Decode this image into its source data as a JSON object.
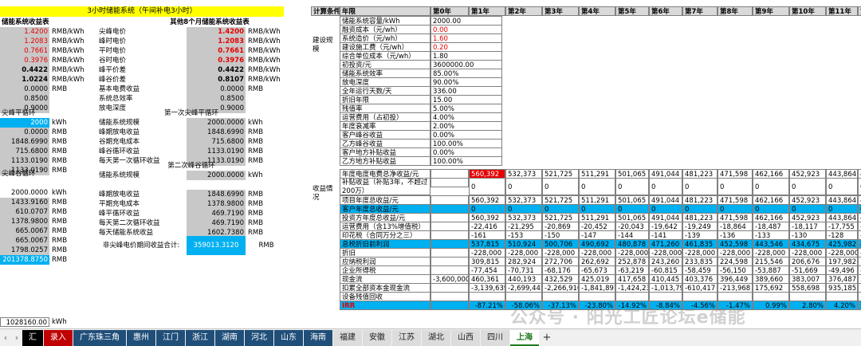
{
  "banner": "3小时储能系统（午间补电3小时）",
  "left": {
    "title": "储能系统收益表",
    "rows": [
      [
        "1.4200",
        "RMB/kWh"
      ],
      [
        "1.2083",
        "RMB/kWh"
      ],
      [
        "0.7661",
        "RMB/kWh"
      ],
      [
        "0.3976",
        "RMB/kWh"
      ],
      [
        "0.4422",
        "RMB/kWh"
      ],
      [
        "1.0224",
        "RMB/kWh"
      ],
      [
        "0.0000",
        "RMB"
      ],
      [
        "0.8500",
        ""
      ],
      [
        "0.9000",
        ""
      ]
    ],
    "sec1": "尖峰平循环",
    "sec1_rows": [
      [
        "2000",
        "kWh"
      ],
      [
        "0.0000",
        "RMB"
      ],
      [
        "1848.6990",
        "RMB"
      ],
      [
        "715.6800",
        "RMB"
      ],
      [
        "1133.0190",
        "RMB"
      ],
      [
        "1133.0190",
        "RMB"
      ]
    ],
    "sec2": "尖峰谷循环",
    "sec2_rows": [
      [
        "2000.0000",
        "kWh"
      ],
      [
        "1433.9160",
        "RMB"
      ],
      [
        "610.0707",
        "RMB"
      ],
      [
        "1378.9800",
        "RMB"
      ],
      [
        "665.0067",
        "RMB"
      ],
      [
        "665.0067",
        "RMB"
      ],
      [
        "1798.0257",
        "RMB"
      ],
      [
        "201378.8750",
        "RMB"
      ]
    ],
    "bottom_value": "1028160.00",
    "bottom_unit": "kWh"
  },
  "middle": {
    "title": "其他8个月储能系统收益表",
    "rows": [
      [
        "尖峰电价",
        "1.4200",
        "RMB/kWh"
      ],
      [
        "峰时电价",
        "1.2083",
        "RMB/kWh"
      ],
      [
        "平时电价",
        "0.7661",
        "RMB/kWh"
      ],
      [
        "谷时电价",
        "0.3976",
        "RMB/kWh"
      ],
      [
        "峰平价差",
        "0.4422",
        "RMB/kWh"
      ],
      [
        "峰谷价差",
        "0.8107",
        "RMB/kWh"
      ],
      [
        "基本电费收益",
        "0.0000",
        "RMB"
      ],
      [
        "系统总效率",
        "0.8500",
        ""
      ],
      [
        "放电深度",
        "0.9000",
        ""
      ]
    ],
    "sec1": "第一次尖峰平循环",
    "sec1_rows": [
      [
        "储能系统规模",
        "2000.0000",
        "kWh"
      ],
      [
        "峰期放电收益",
        "1848.6990",
        "RMB"
      ],
      [
        "谷期充电成本",
        "715.6800",
        "RMB"
      ],
      [
        "峰谷循环收益",
        "1133.0190",
        "RMB"
      ],
      [
        "每天第一次循环收益",
        "1133.0190",
        "RMB"
      ]
    ],
    "sec2": "第二次峰谷循环",
    "sec2_rows": [
      [
        "储能系统规模",
        "2000.0000",
        "kWh"
      ],
      [
        "",
        "",
        ""
      ],
      [
        "峰期放电收益",
        "1848.6990",
        "RMB"
      ],
      [
        "平期充电成本",
        "1378.9800",
        "RMB"
      ],
      [
        "峰平循环收益",
        "469.7190",
        "RMB"
      ],
      [
        "每天第二次循环收益",
        "469.7190",
        "RMB"
      ],
      [
        "每天储能系统收益",
        "1602.7380",
        "RMB"
      ]
    ],
    "total_label": "非尖峰电价期间收益合计:",
    "total_value": "359013.3120",
    "total_unit": "RMB"
  },
  "right": {
    "header": [
      "计算条件",
      "年限",
      "第0年",
      "第1年",
      "第2年",
      "第3年",
      "第4年",
      "第5年",
      "第6年",
      "第7年",
      "第8年",
      "第9年",
      "第10年",
      "第11年",
      "第"
    ],
    "cond_label": "建设规模",
    "cond_rows": [
      [
        "储能系统容量/kWh",
        "2000.00"
      ],
      [
        "融资成本（元/wh）",
        "0.00"
      ],
      [
        "系统造价（元/wh）",
        "1.60"
      ],
      [
        "建设施工费（元/wh）",
        "0.20"
      ],
      [
        "综合单位成本（元/wh）",
        "1.80"
      ],
      [
        "初投资/元",
        "3600000.00"
      ],
      [
        "储能系统效率",
        "85.00%"
      ],
      [
        "放电深度",
        "90.00%"
      ],
      [
        "全年运行天数/天",
        "336.00"
      ],
      [
        "折旧年限",
        "15.00"
      ],
      [
        "残值率",
        "5.00%"
      ],
      [
        "运营费用（占初投）",
        "4.00%"
      ],
      [
        "年度衰减率",
        "2.00%"
      ],
      [
        "客户峰谷收益",
        "0.00%"
      ],
      [
        "乙方峰谷收益",
        "100.00%"
      ],
      [
        "客户地方补贴收益",
        "0.00%"
      ],
      [
        "乙方地方补贴收益",
        "100.00%"
      ]
    ],
    "rev_label": "收益情况",
    "rev_rows": [
      {
        "label": "年度电度电费总净收益/元",
        "y0": "",
        "vals": [
          "560,392",
          "532,373",
          "521,725",
          "511,291",
          "501,065",
          "491,044",
          "481,223",
          "471,598",
          "462,166",
          "452,923",
          "443,864",
          "43"
        ],
        "style": "first-red"
      },
      {
        "label": "补贴收益（补贴3年，不超过200万）",
        "y0": "",
        "vals": [
          "0",
          "0",
          "0",
          "0",
          "0",
          "0",
          "0",
          "0",
          "0",
          "0",
          "0",
          "0"
        ],
        "style": "tall"
      },
      {
        "label": "项目年度总收益/元",
        "y0": "",
        "vals": [
          "560,392",
          "532,373",
          "521,725",
          "511,291",
          "501,065",
          "491,044",
          "481,223",
          "471,598",
          "462,166",
          "452,923",
          "443,864",
          "43"
        ],
        "style": ""
      },
      {
        "label": "客户年度总收益/元",
        "y0": "",
        "vals": [
          "0",
          "0",
          "0",
          "0",
          "0",
          "0",
          "0",
          "0",
          "0",
          "0",
          "0",
          "0"
        ],
        "style": "blue"
      },
      {
        "label": "投资方年度总收益/元",
        "y0": "",
        "vals": [
          "560,392",
          "532,373",
          "521,725",
          "511,291",
          "501,065",
          "491,044",
          "481,223",
          "471,598",
          "462,166",
          "452,923",
          "443,864",
          "43"
        ],
        "style": ""
      },
      {
        "label": "运营费用（含13%增值税）",
        "y0": "",
        "vals": [
          "-22,416",
          "-21,295",
          "-20,869",
          "-20,452",
          "-20,043",
          "-19,642",
          "-19,249",
          "-18,864",
          "-18,487",
          "-18,117",
          "-17,755",
          "-1"
        ],
        "style": ""
      },
      {
        "label": "印花税（合同万分之三）",
        "y0": "",
        "vals": [
          "-161",
          "-153",
          "-150",
          "-147",
          "-144",
          "-141",
          "-139",
          "-136",
          "-133",
          "-130",
          "-128",
          "-1"
        ],
        "style": ""
      },
      {
        "label": "息税折旧前利润",
        "y0": "",
        "vals": [
          "537,815",
          "510,924",
          "500,706",
          "490,692",
          "480,878",
          "471,260",
          "461,835",
          "452,598",
          "443,546",
          "434,675",
          "425,982",
          "41"
        ],
        "style": "blue"
      },
      {
        "label": "折旧",
        "y0": "",
        "vals": [
          "-228,000",
          "-228,000",
          "-228,000",
          "-228,000",
          "-228,000",
          "-228,000",
          "-228,000",
          "-228,000",
          "-228,000",
          "-228,000",
          "-228,000",
          "-2"
        ],
        "style": ""
      },
      {
        "label": "应纳税利润",
        "y0": "",
        "vals": [
          "309,815",
          "282,924",
          "272,706",
          "262,692",
          "252,878",
          "243,260",
          "233,835",
          "224,598",
          "215,546",
          "206,676",
          "197,982",
          "18"
        ],
        "style": ""
      },
      {
        "label": "企业所得税",
        "y0": "",
        "vals": [
          "-77,454",
          "-70,731",
          "-68,176",
          "-65,673",
          "-63,219",
          "-60,815",
          "-58,459",
          "-56,150",
          "-53,887",
          "-51,669",
          "-49,496",
          "-4"
        ],
        "style": ""
      },
      {
        "label": "现金流",
        "y0": "-3,600,000",
        "vals": [
          "460,361",
          "440,193",
          "432,529",
          "425,019",
          "417,658",
          "410,445",
          "403,376",
          "396,449",
          "389,660",
          "383,007",
          "376,487",
          "37"
        ],
        "style": ""
      },
      {
        "label": "扣累全部资本金现金流",
        "y0": "",
        "vals": [
          "-3,139,639",
          "-2,699,445",
          "-2,266,916",
          "-1,841,897",
          "-1,424,239",
          "-1,013,793",
          "-610,417",
          "-213,968",
          "175,692",
          "558,698",
          "935,185",
          "1,3"
        ],
        "style": ""
      },
      {
        "label": "设备残值回收",
        "y0": "",
        "vals": [
          "",
          "",
          "",
          "",
          "",
          "",
          "",
          "",
          "",
          "",
          "",
          ""
        ],
        "style": ""
      },
      {
        "label": "IRR",
        "y0": "",
        "vals": [
          "-87.21%",
          "-58.06%",
          "-37.13%",
          "-23.80%",
          "-14.92%",
          "-8.84%",
          "-4.56%",
          "-1.47%",
          "0.99%",
          "2.80%",
          "4.20%",
          "5"
        ],
        "style": "blue-irr"
      }
    ]
  },
  "tabs": {
    "nav_prev": "‹",
    "nav_next": "›",
    "items": [
      {
        "label": "汇",
        "kind": "black"
      },
      {
        "label": "录入",
        "kind": "redtab"
      },
      {
        "label": "广东珠三角",
        "kind": "blue"
      },
      {
        "label": "惠州",
        "kind": "blue"
      },
      {
        "label": "江门",
        "kind": "blue"
      },
      {
        "label": "浙江",
        "kind": "blue"
      },
      {
        "label": "湖南",
        "kind": "blue"
      },
      {
        "label": "河北",
        "kind": "blue"
      },
      {
        "label": "山东",
        "kind": "blue"
      },
      {
        "label": "海南",
        "kind": "blue"
      },
      {
        "label": "福建",
        "kind": "light"
      },
      {
        "label": "安徽",
        "kind": "light"
      },
      {
        "label": "江苏",
        "kind": "light"
      },
      {
        "label": "湖北",
        "kind": "light"
      },
      {
        "label": "山西",
        "kind": "light"
      },
      {
        "label": "四川",
        "kind": "light"
      },
      {
        "label": "上海",
        "kind": "active"
      }
    ],
    "add": "+"
  },
  "watermark": "公众号 · 阳光工匠论坛e储能"
}
